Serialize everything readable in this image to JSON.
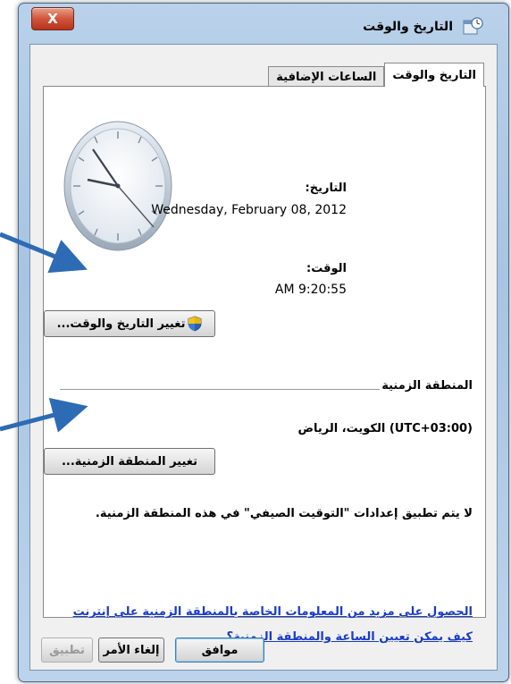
{
  "window": {
    "title": "التاريخ والوقت",
    "close_label": "X"
  },
  "tabs": [
    {
      "label": "التاريخ والوقت",
      "active": true
    },
    {
      "label": "الساعات الإضافية",
      "active": false
    }
  ],
  "datetime": {
    "date_label": "التاريخ:",
    "date_value": "Wednesday, February 08, 2012",
    "time_label": "الوقت:",
    "time_value": "AM 9:20:55",
    "change_button": "تغيير التاريخ والوقت..."
  },
  "timezone": {
    "section_label": "المنطقة الزمنية",
    "value": "(UTC+03:00) الكويت، الرياض",
    "change_button": "تغيير المنطقة الزمنية...",
    "dst_note": "لا يتم تطبيق إعدادات \"التوقيت الصيفي\" في هذه المنطقة الزمنية."
  },
  "links": {
    "more_info": "الحصول على مزيد من المعلومات الخاصة بالمنطقة الزمنية على إنترنت",
    "how_to": "كيف يمكن تعيين الساعة والمنطقة الزمنية؟"
  },
  "footer": {
    "ok": "موافق",
    "cancel": "إلغاء الأمر",
    "apply": "تطبيق"
  },
  "colors": {
    "link": "#1a3cc8",
    "arrow": "#2e6bb5"
  },
  "icons": [
    "close-icon",
    "date-time-app-icon",
    "clock-icon",
    "uac-shield-icon",
    "pointer-arrow-icon"
  ]
}
